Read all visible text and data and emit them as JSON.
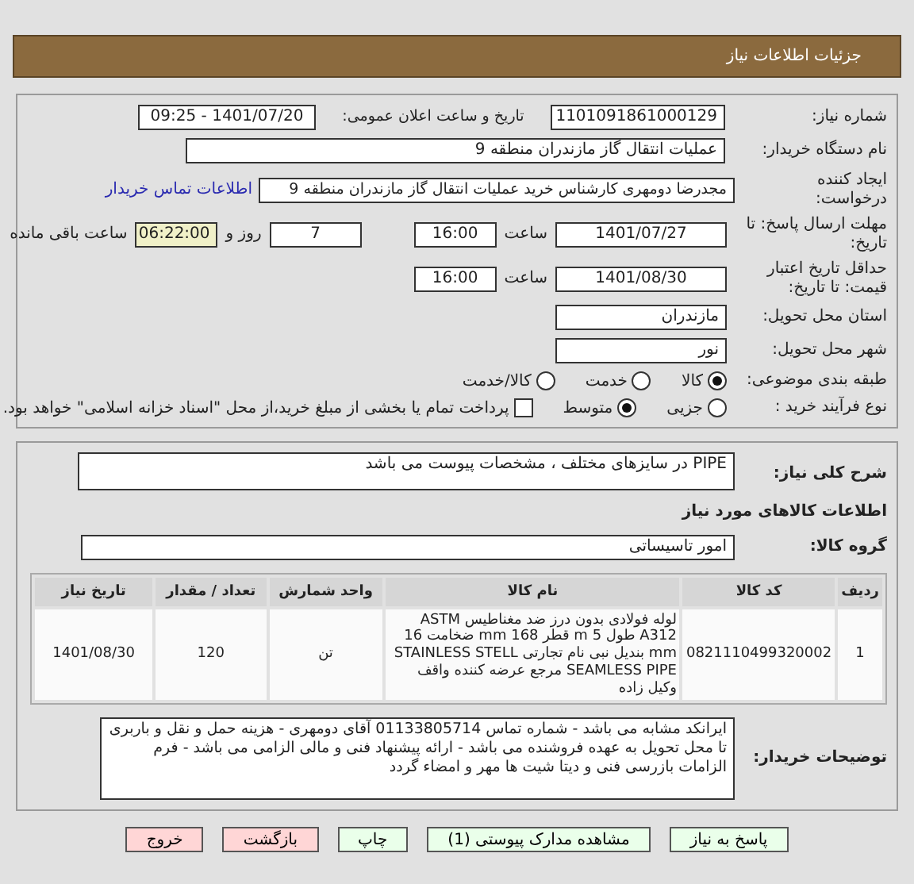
{
  "header": {
    "title": "جزئیات اطلاعات نیاز"
  },
  "need_number": {
    "label": "شماره نیاز:",
    "value": "1101091861000129"
  },
  "announce": {
    "label": "تاریخ و ساعت اعلان عمومی:",
    "value": "1401/07/20 - 09:25"
  },
  "buyer_org": {
    "label": "نام دستگاه خریدار:",
    "value": "عملیات انتقال گاز مازندران منطقه 9"
  },
  "requester": {
    "label": "ایجاد کننده درخواست:",
    "value": "مجدرضا دومهری کارشناس خرید عملیات انتقال گاز مازندران منطقه 9",
    "link": "اطلاعات تماس خریدار"
  },
  "reply_deadline": {
    "label": "مهلت ارسال پاسخ: تا تاریخ:",
    "date": "1401/07/27",
    "time_label": "ساعت",
    "time": "16:00",
    "days": "7",
    "days_label": "روز و",
    "remaining": "06:22:00",
    "remaining_label": "ساعت باقی مانده"
  },
  "price_validity": {
    "label": "حداقل تاریخ اعتبار قیمت: تا تاریخ:",
    "date": "1401/08/30",
    "time_label": "ساعت",
    "time": "16:00"
  },
  "province": {
    "label": "استان محل تحویل:",
    "value": "مازندران"
  },
  "city": {
    "label": "شهر محل تحویل:",
    "value": "نور"
  },
  "category": {
    "label": "طبقه بندی موضوعی:",
    "options": [
      {
        "label": "کالا",
        "selected": true
      },
      {
        "label": "خدمت",
        "selected": false
      },
      {
        "label": "کالا/خدمت",
        "selected": false
      }
    ]
  },
  "purchase_type": {
    "label": "نوع فرآیند خرید :",
    "options": [
      {
        "label": "جزیی",
        "selected": false
      },
      {
        "label": "متوسط",
        "selected": true
      }
    ],
    "payment": {
      "checked": false,
      "text": "پرداخت تمام یا بخشی از مبلغ خرید،از محل \"اسناد خزانه اسلامی\" خواهد بود."
    }
  },
  "description": {
    "label": "شرح کلی نیاز:",
    "value": "PIPE در سایزهای مختلف ، مشخصات پیوست می باشد"
  },
  "goods_title": "اطلاعات کالاهای مورد نیاز",
  "goods_group": {
    "label": "گروه کالا:",
    "value": "امور تاسیساتی"
  },
  "table": {
    "columns": [
      "ردیف",
      "کد کالا",
      "نام کالا",
      "واحد شمارش",
      "تعداد / مقدار",
      "تاریخ نیاز"
    ],
    "rows": [
      [
        "1",
        "0821110499320002",
        "لوله فولادی بدون درز ضد مغناطیس ASTM A312 طول 5 m قطر 168 mm ضخامت 16 mm بندیل نبی نام تجارتی STAINLESS STELL SEAMLESS PIPE مرجع عرضه کننده واقف وکیل زاده",
        "تن",
        "120",
        "1401/08/30"
      ]
    ]
  },
  "buyer_notes": {
    "label": "توضیحات خریدار:",
    "value": "ایرانکد مشابه می باشد - شماره تماس 01133805714 آقای دومهری - هزینه حمل و نقل و باربری تا محل تحویل به عهده فروشنده می باشد - ارائه پیشنهاد فنی و مالی الزامی می باشد - فرم الزامات بازرسی فنی و دیتا شیت ها مهر و امضاء گردد"
  },
  "buttons": [
    {
      "label": "پاسخ به نیاز",
      "kind": "action"
    },
    {
      "label": "مشاهده مدارک پیوستی (1)",
      "kind": "action"
    },
    {
      "label": "چاپ",
      "kind": "action"
    },
    {
      "label": "بازگشت",
      "kind": "exit"
    },
    {
      "label": "خروج",
      "kind": "exit"
    }
  ]
}
